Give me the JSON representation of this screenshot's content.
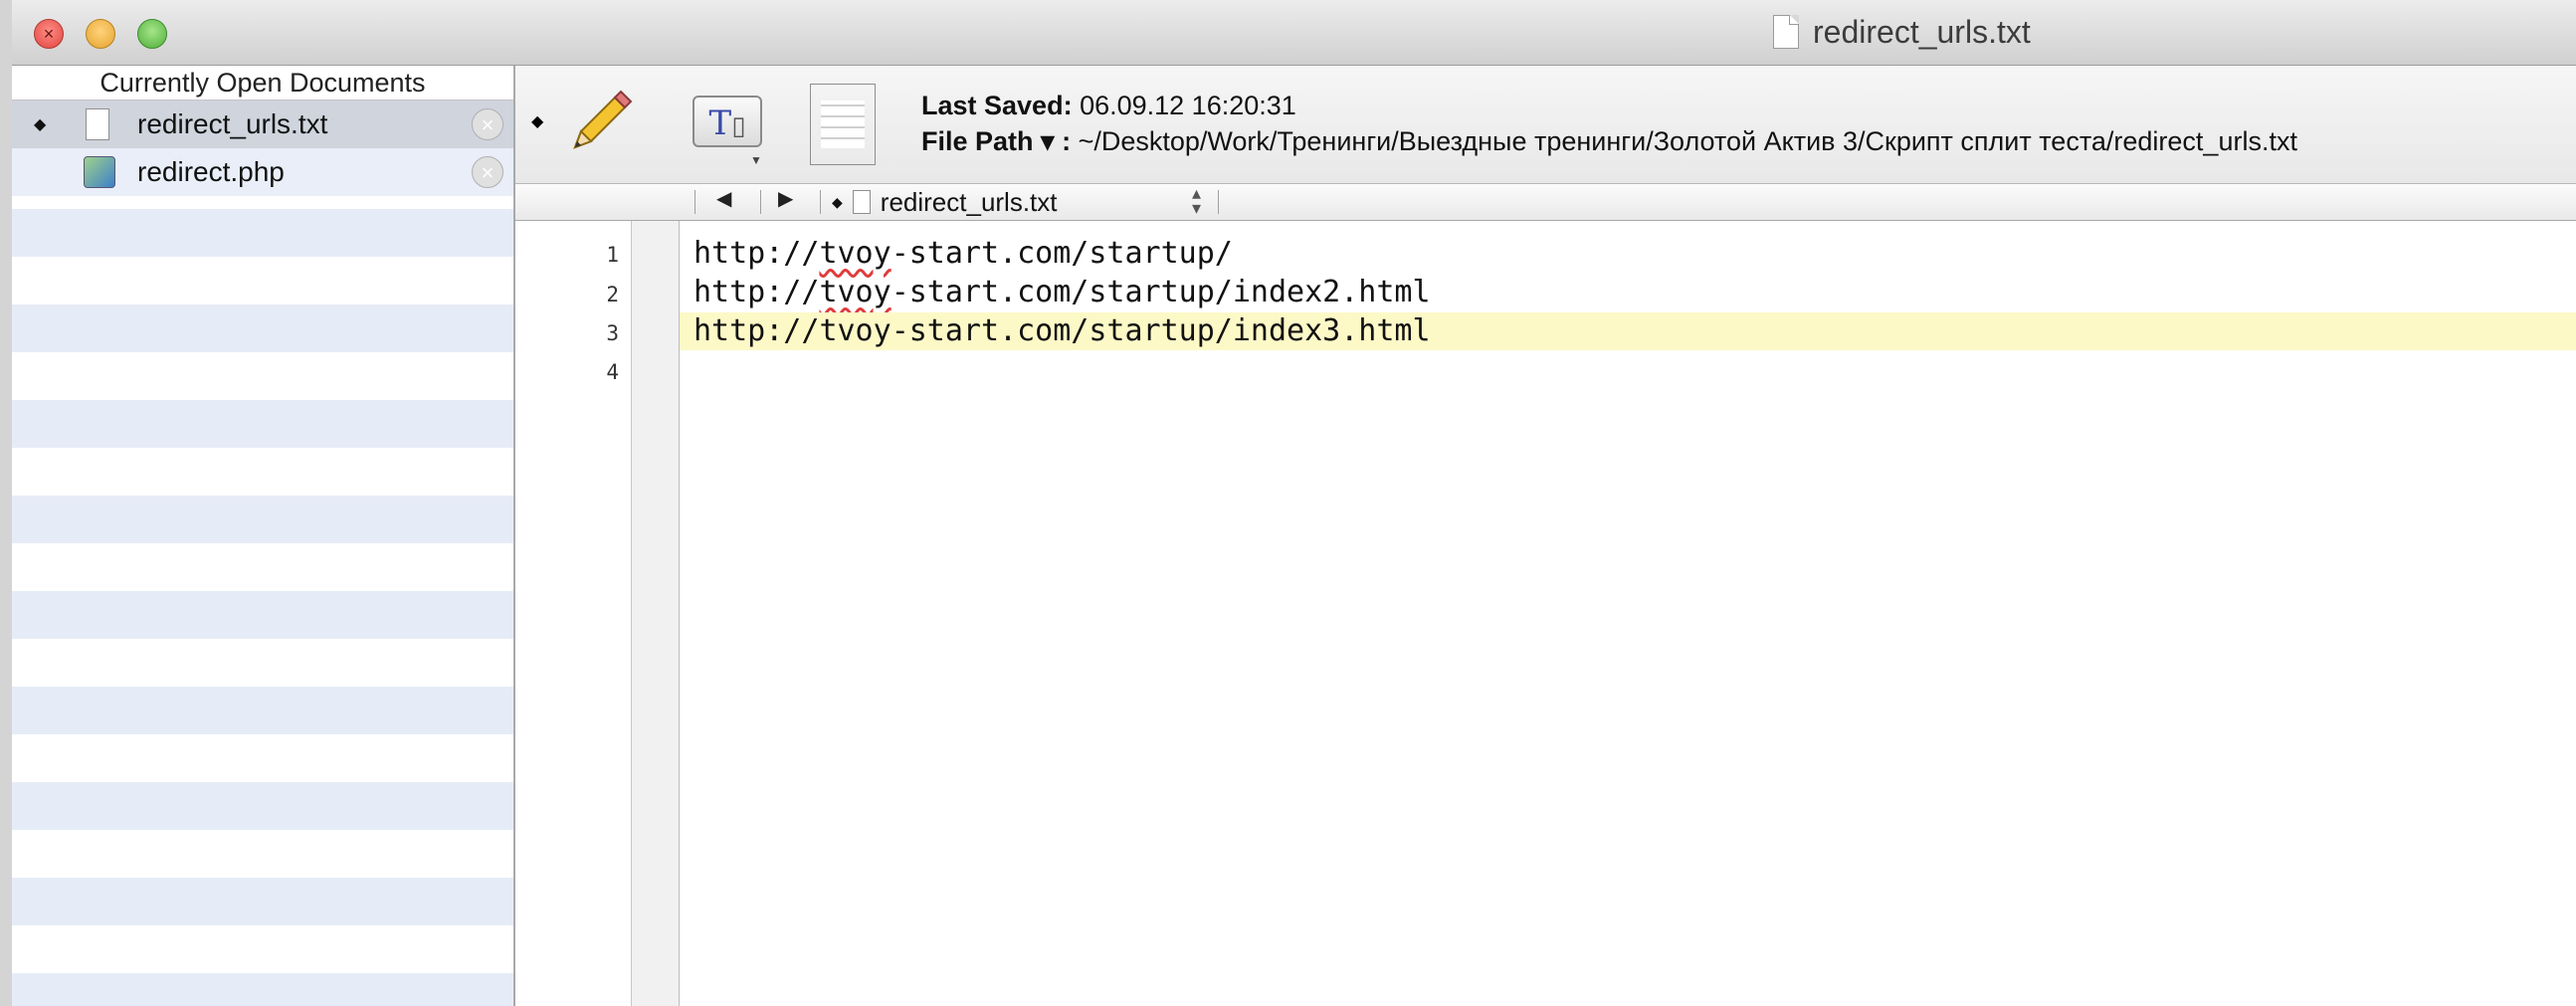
{
  "window": {
    "title": "redirect_urls.txt"
  },
  "sidebar": {
    "header": "Currently Open Documents",
    "items": [
      {
        "label": "redirect_urls.txt",
        "selected": true
      },
      {
        "label": "redirect.php",
        "selected": false
      }
    ]
  },
  "toolbar": {
    "last_saved_label": "Last Saved:",
    "last_saved_value": "06.09.12 16:20:31",
    "file_path_label": "File Path ▾ :",
    "file_path_value": "~/Desktop/Work/Тренинги/Выездные тренинги/Золотой Актив 3/Скрипт сплит теста/redirect_urls.txt",
    "text_button": "T"
  },
  "navbar": {
    "file": "redirect_urls.txt"
  },
  "editor": {
    "line_numbers": [
      "1",
      "2",
      "3",
      "4"
    ],
    "lines": [
      {
        "pre": "http://",
        "typo": "tvoy",
        "post": "-start.com/startup/"
      },
      {
        "pre": "http://",
        "typo": "tvoy",
        "post": "-start.com/startup/index2.html"
      },
      {
        "pre": "http://",
        "typo": "tvoy",
        "post": "-start.com/startup/index3.html"
      },
      {
        "pre": "",
        "typo": "",
        "post": ""
      }
    ],
    "current_line": 3
  }
}
